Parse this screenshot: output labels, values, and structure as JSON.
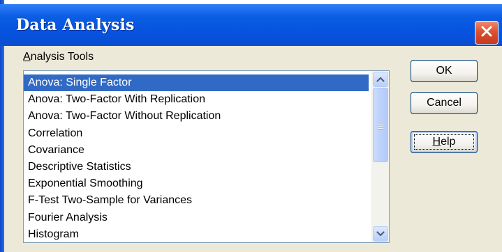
{
  "window": {
    "title": "Data Analysis"
  },
  "dialog": {
    "list_label_mnemonic": "A",
    "list_label_rest": "nalysis Tools",
    "tools": [
      "Anova: Single Factor",
      "Anova: Two-Factor With Replication",
      "Anova: Two-Factor Without Replication",
      "Correlation",
      "Covariance",
      "Descriptive Statistics",
      "Exponential Smoothing",
      "F-Test Two-Sample for Variances",
      "Fourier Analysis",
      "Histogram"
    ],
    "selected": "Anova: Single Factor"
  },
  "buttons": {
    "ok": "OK",
    "cancel": "Cancel",
    "help_mnemonic": "H",
    "help_rest": "elp"
  },
  "icons": {
    "close": "close-icon",
    "scroll_up": "chevron-up-icon",
    "scroll_down": "chevron-down-icon",
    "scroll_grip": "grip-icon"
  },
  "colors": {
    "titlebar": "#0a5ee3",
    "selection": "#316ac5",
    "close_button": "#dc5230",
    "dialog_background": "#ece9d8"
  }
}
